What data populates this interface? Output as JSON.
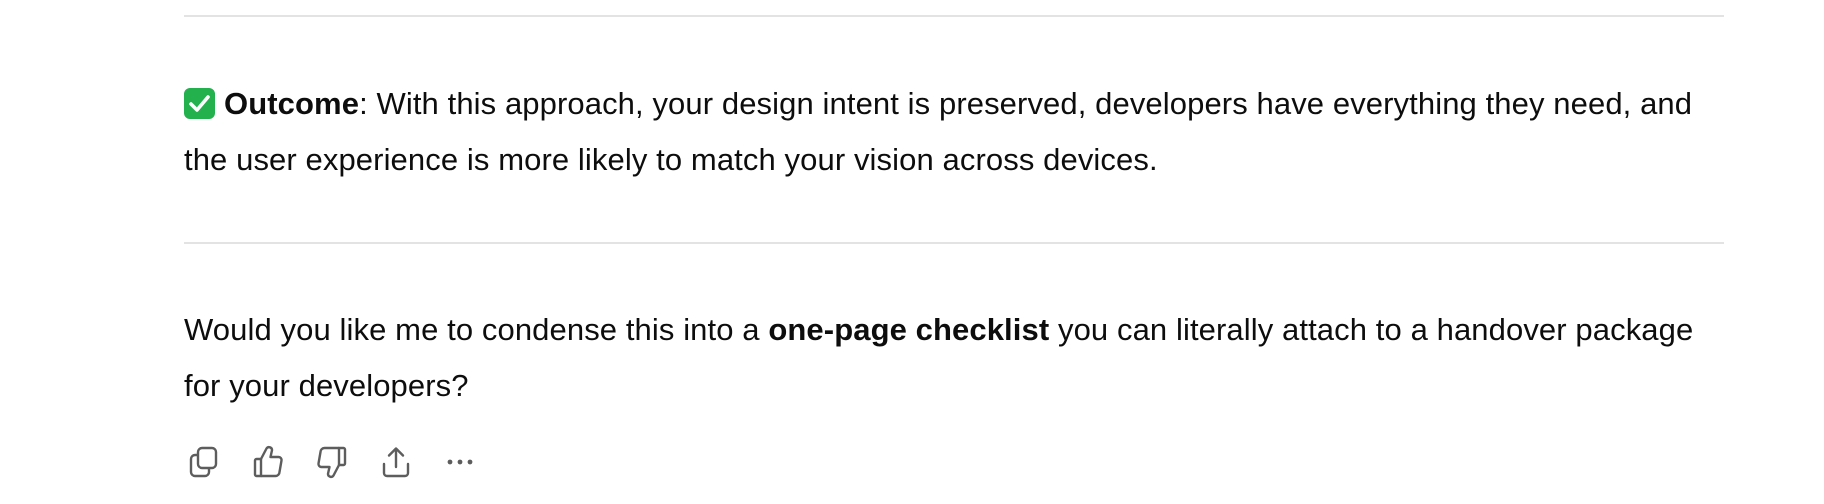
{
  "outcome": {
    "icon": "check-mark-button-icon",
    "label": "Outcome",
    "text": ": With this approach, your design intent is preserved, developers have everything they need, and the user experience is more likely to match your vision across devices."
  },
  "followup": {
    "before": "Would you like me to condense this into a ",
    "bold": "one-page checklist",
    "after": " you can literally attach to a handover package for your developers?"
  },
  "actions": [
    {
      "icon": "copy-icon"
    },
    {
      "icon": "thumbs-up-icon"
    },
    {
      "icon": "thumbs-down-icon"
    },
    {
      "icon": "share-icon"
    },
    {
      "icon": "more-options-icon"
    }
  ],
  "colors": {
    "text": "#0d0d0d",
    "divider": "#e3e3e3",
    "check_green": "#22b14c",
    "icon": "#5d5d5d"
  }
}
